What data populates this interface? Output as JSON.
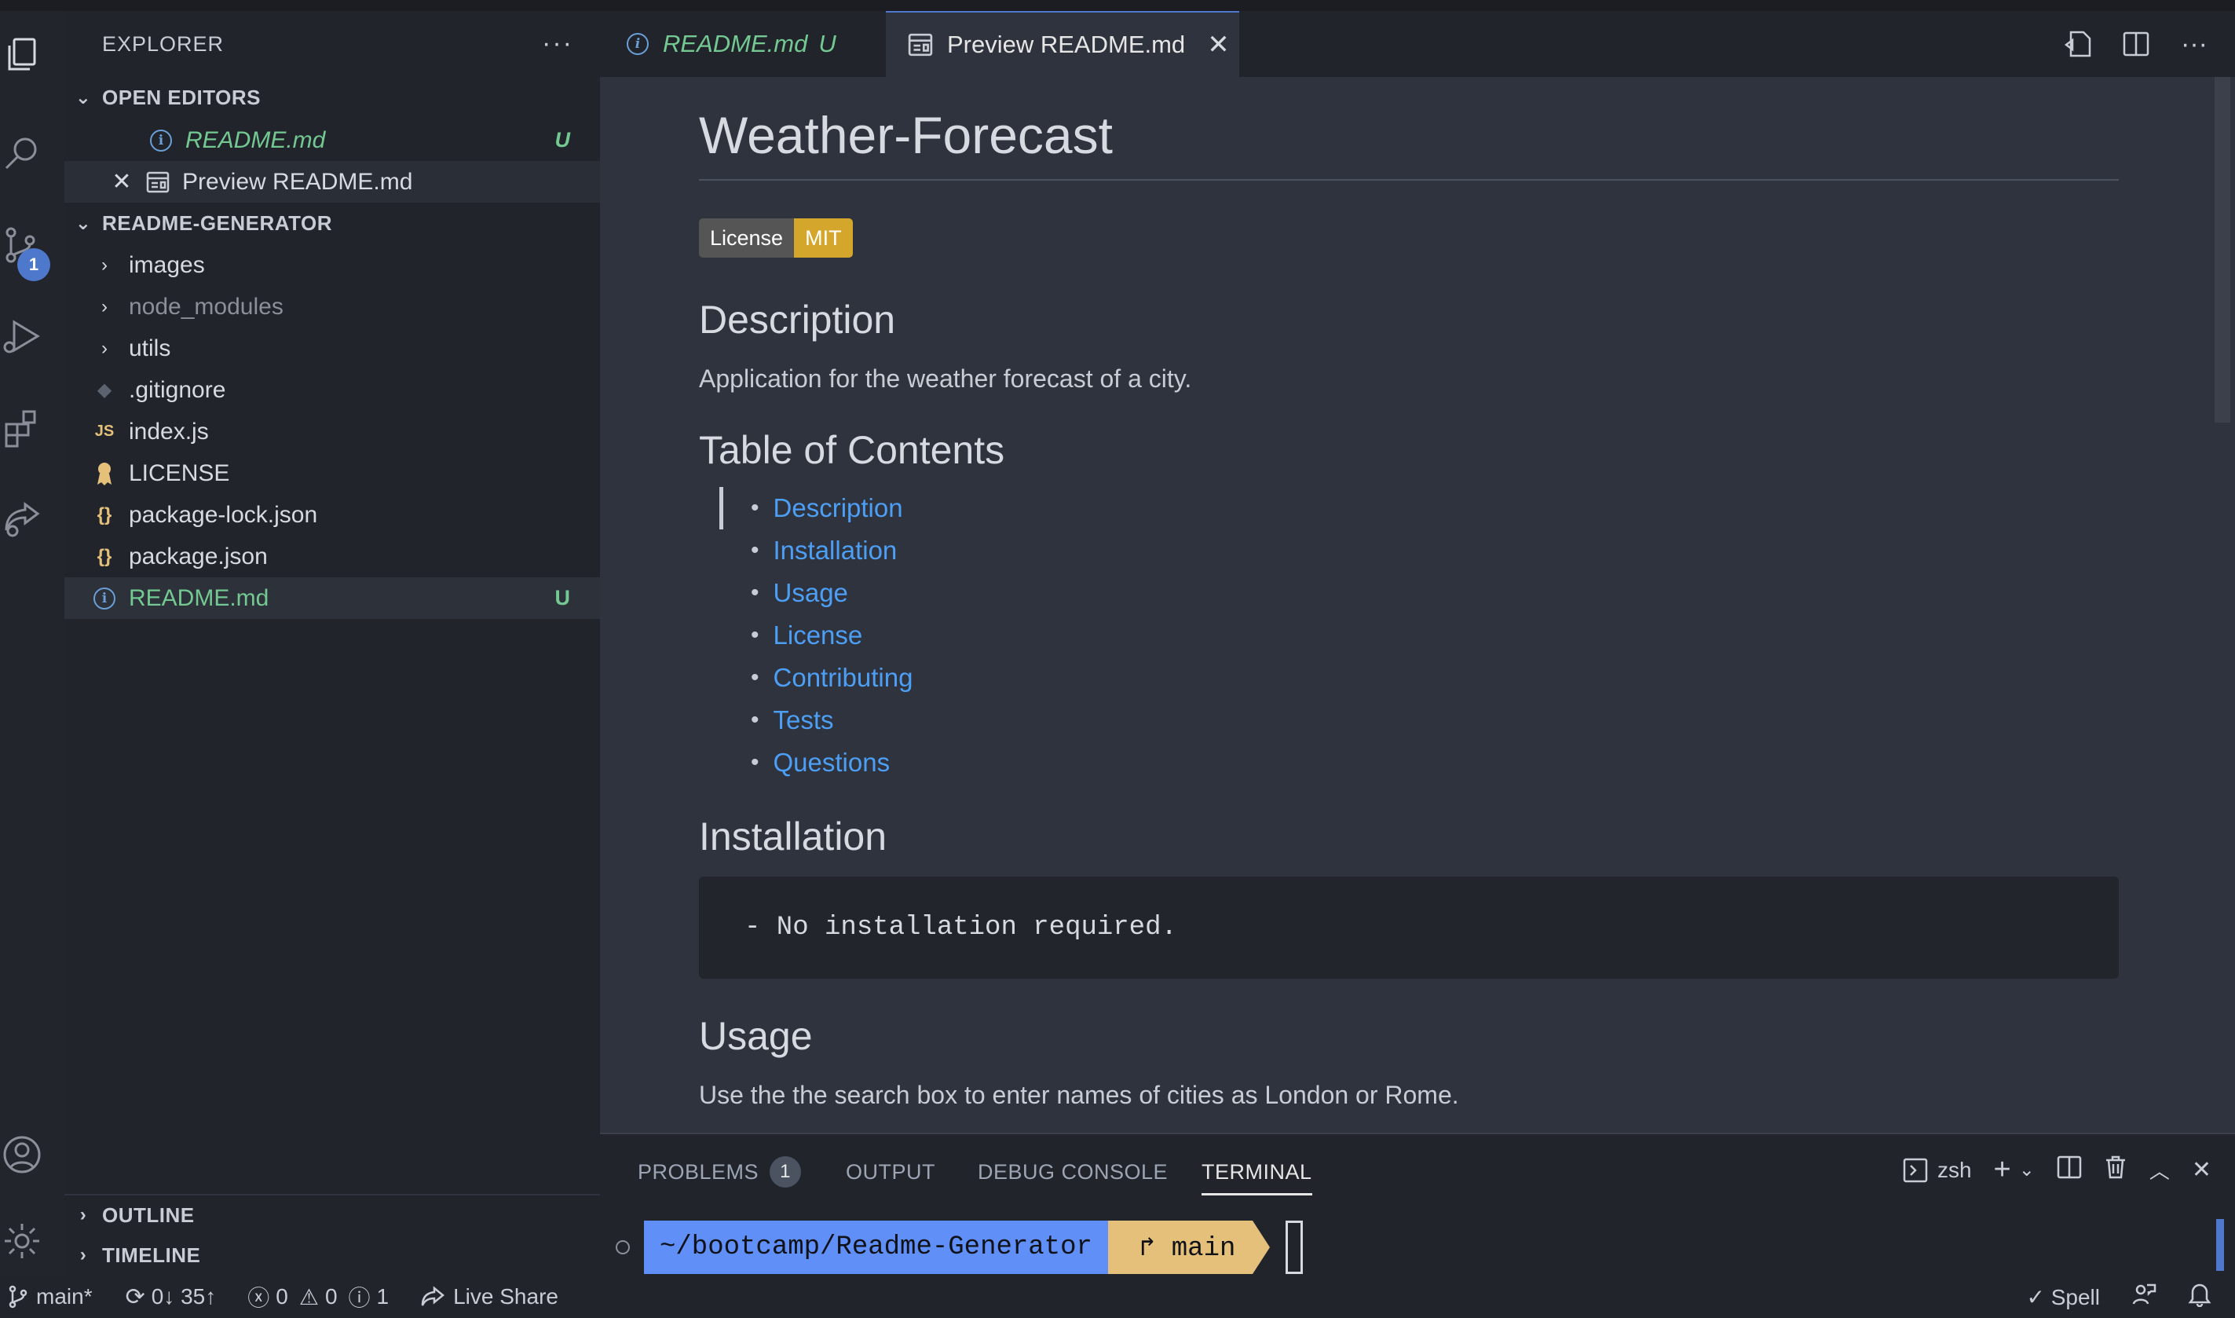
{
  "sidebar": {
    "title": "EXPLORER",
    "more": "···",
    "open_editors": {
      "title": "OPEN EDITORS",
      "items": [
        {
          "label": "README.md",
          "status": "U"
        },
        {
          "label": "Preview README.md"
        }
      ]
    },
    "project": {
      "title": "README-GENERATOR",
      "items": [
        {
          "label": "images",
          "type": "folder"
        },
        {
          "label": "node_modules",
          "type": "folder"
        },
        {
          "label": "utils",
          "type": "folder"
        },
        {
          "label": ".gitignore",
          "type": "file"
        },
        {
          "label": "index.js",
          "type": "file",
          "icon_text": "JS"
        },
        {
          "label": "LICENSE",
          "type": "file"
        },
        {
          "label": "package-lock.json",
          "type": "file",
          "icon_text": "{}"
        },
        {
          "label": "package.json",
          "type": "file",
          "icon_text": "{}"
        },
        {
          "label": "README.md",
          "type": "file",
          "status": "U"
        }
      ]
    },
    "outline": "OUTLINE",
    "timeline": "TIMELINE"
  },
  "activity": {
    "scm_badge": "1"
  },
  "tabs": [
    {
      "label": "README.md",
      "status": "U"
    },
    {
      "label": "Preview README.md"
    }
  ],
  "preview": {
    "title": "Weather-Forecast",
    "badge_left": "License",
    "badge_right": "MIT",
    "description_heading": "Description",
    "description_text": "Application for the weather forecast of a city.",
    "toc_heading": "Table of Contents",
    "toc": [
      "Description",
      "Installation",
      "Usage",
      "License",
      "Contributing",
      "Tests",
      "Questions"
    ],
    "installation_heading": "Installation",
    "installation_code": "- No installation required.",
    "usage_heading": "Usage",
    "usage_text": "Use the the search box to enter names of cities as London or Rome."
  },
  "panel": {
    "tabs": {
      "problems": "PROBLEMS",
      "problems_count": "1",
      "output": "OUTPUT",
      "debug": "DEBUG CONSOLE",
      "terminal": "TERMINAL"
    },
    "shell": "zsh",
    "prompt_path": "~/bootcamp/Readme-Generator",
    "prompt_branch": "↱ main"
  },
  "status": {
    "branch": "main*",
    "sync": "0↓ 35↑",
    "errors": "0",
    "warnings": "0",
    "infos": "1",
    "live_share": "Live Share",
    "spell": "Spell"
  }
}
